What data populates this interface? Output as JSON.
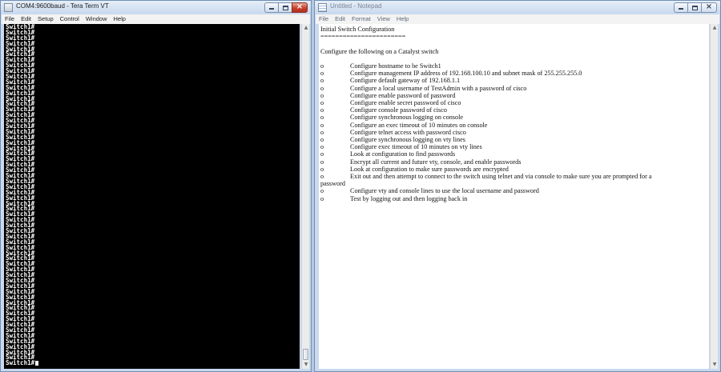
{
  "terminal_window": {
    "title": "COM4:9600baud - Tera Term VT",
    "menu": [
      "File",
      "Edit",
      "Setup",
      "Control",
      "Window",
      "Help"
    ],
    "prompt": "Switch1#",
    "line_count": 62
  },
  "notepad_window": {
    "title": "Untitled - Notepad",
    "menu": [
      "File",
      "Edit",
      "Format",
      "View",
      "Help"
    ],
    "heading": "Initial Switch Configuration",
    "underline": "=======================",
    "intro": "Configure the following on a Catalyst switch",
    "bullet_marker": "o",
    "items": [
      "Configure hostname to be Switch1",
      "Configure management IP address of 192.168.100.10 and subnet mask of 255.255.255.0",
      "Configure default gateway of 192.168.1.1",
      "Configure a local username of TestAdmin with a password of cisco",
      "Configure enable password of password",
      "Configure enable secret password of cisco",
      "Configure console password of cisco",
      "Configure synchronous logging on console",
      "Configure an exec timeout of 10 minutes on console",
      "Configure telnet access with password cisco",
      "Configure synchronous logging on vty lines",
      "Configure exec timeout of 10 minutes on vty lines",
      "Look at configuration to find passwords",
      "Encrypt all current and future vty, console, and enable passwords",
      "Look at configuration to make sure passwords are encrypted"
    ],
    "wrapped_item_line1": "Exit out and then attempt to connect to the switch using telnet and via console to make sure you are prompted for a",
    "wrapped_item_line2": "password",
    "items_after": [
      "Configure vty and console lines to use the local username and password",
      "Test by logging out and then logging back in"
    ]
  },
  "colors": {
    "terminal_background": "#000000",
    "terminal_text": "#ffffff",
    "close_button": "#c5402c"
  },
  "icons": {
    "tera-term": "tera-term-icon",
    "notepad": "notepad-icon"
  }
}
